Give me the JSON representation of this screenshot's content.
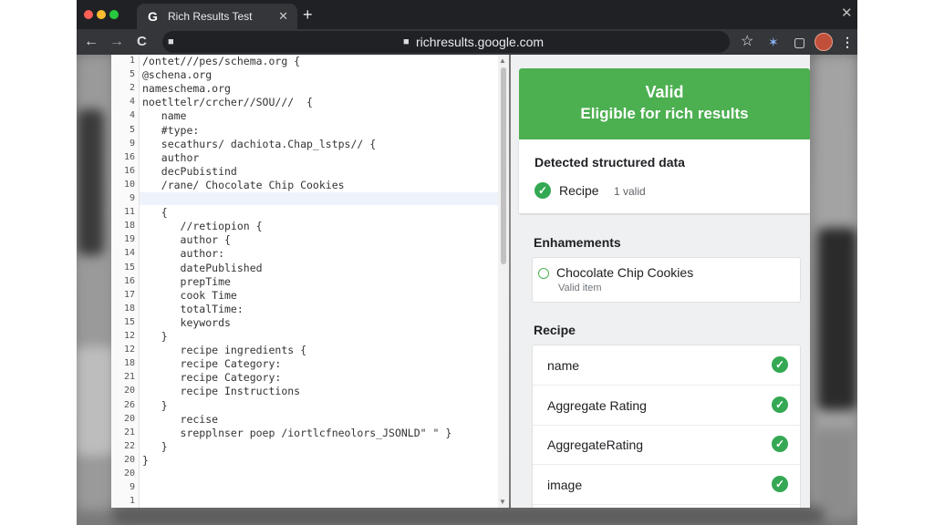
{
  "browser": {
    "tab_title": "Rich Results Test",
    "tab_icon": "G",
    "tab_close": "✕",
    "new_tab": "+",
    "url": "richresults.google.com",
    "window_close": "✕",
    "back": "←",
    "forward": "→",
    "reload": "C",
    "star": "☆",
    "ext_star": "✶",
    "panel": "▢",
    "menu": "⋮",
    "traffic_colors": [
      "#ff5f57",
      "#febc2e",
      "#28c840"
    ]
  },
  "code": {
    "line_numbers": [
      "1",
      "5",
      "2",
      "4",
      "4",
      "5",
      "9",
      "16",
      "16",
      "10",
      "9",
      "11",
      "18",
      "19",
      "14",
      "15",
      "16",
      "17",
      "18",
      "15",
      "12",
      "12",
      "18",
      "21",
      "20",
      "26",
      "20",
      "21",
      "22",
      "20",
      "20",
      "9",
      "1"
    ],
    "lines": [
      "/ontet///pes/schema.org {",
      "@schena.org",
      "nameschema.org",
      "noetltelr/crcher//SOU///  {",
      "   name",
      "   #type:",
      "   secathurs/ dachiota.Chap_lstps// {",
      "   author",
      "   decPubistind",
      "   /rane/ Chocolate Chip Cookies",
      "",
      "   {",
      "      //retiopion {",
      "      author {",
      "      author:",
      "      datePublished",
      "      prepTime",
      "      cook Time",
      "      totalTime:",
      "      keywords",
      "   }",
      "      recipe ingredients {",
      "      recipe Category:",
      "      recipe Category:",
      "      recipe Instructions",
      "   }",
      "      recise",
      "      srepplnser poep /iortlcfneolors_JSONLD\" \" }",
      "   }",
      "}",
      "",
      "",
      ""
    ]
  },
  "results": {
    "banner_status": "Valid",
    "banner_sub": "Eligible for rich results",
    "detected_title": "Detected structured data",
    "detected_item": "Recipe",
    "detected_count": "1 valid",
    "enhancements_title": "Enhamements",
    "enh_item": "Chocolate Chip Cookies",
    "enh_item_sub": "Valid item",
    "recipe_title": "Recipe",
    "recipe_fields": [
      "name",
      "Aggregate Rating",
      "AggregateRating",
      "image"
    ],
    "check_glyph": "✓"
  },
  "colors": {
    "valid_green": "#4caf50",
    "check_green": "#34a853"
  }
}
